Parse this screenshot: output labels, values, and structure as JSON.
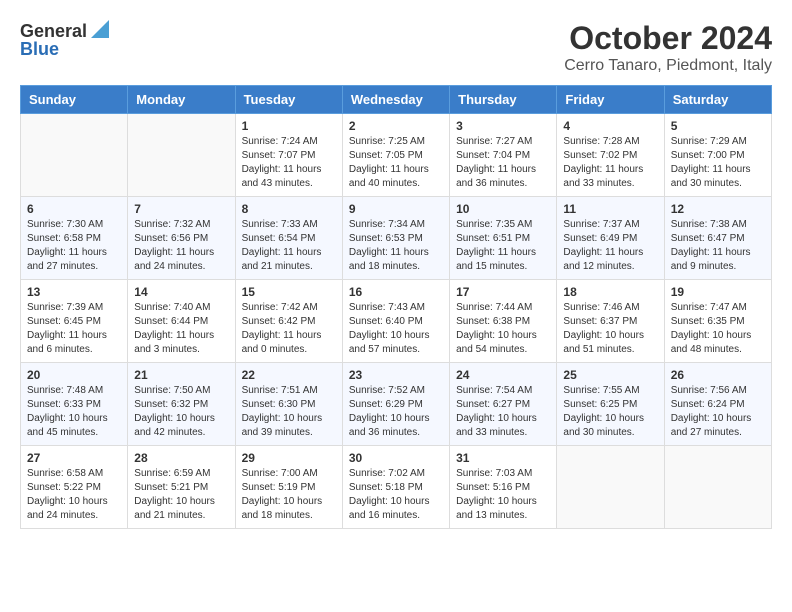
{
  "header": {
    "logo_general": "General",
    "logo_blue": "Blue",
    "month": "October 2024",
    "location": "Cerro Tanaro, Piedmont, Italy"
  },
  "weekdays": [
    "Sunday",
    "Monday",
    "Tuesday",
    "Wednesday",
    "Thursday",
    "Friday",
    "Saturday"
  ],
  "weeks": [
    [
      {
        "day": "",
        "sunrise": "",
        "sunset": "",
        "daylight": ""
      },
      {
        "day": "",
        "sunrise": "",
        "sunset": "",
        "daylight": ""
      },
      {
        "day": "1",
        "sunrise": "Sunrise: 7:24 AM",
        "sunset": "Sunset: 7:07 PM",
        "daylight": "Daylight: 11 hours and 43 minutes."
      },
      {
        "day": "2",
        "sunrise": "Sunrise: 7:25 AM",
        "sunset": "Sunset: 7:05 PM",
        "daylight": "Daylight: 11 hours and 40 minutes."
      },
      {
        "day": "3",
        "sunrise": "Sunrise: 7:27 AM",
        "sunset": "Sunset: 7:04 PM",
        "daylight": "Daylight: 11 hours and 36 minutes."
      },
      {
        "day": "4",
        "sunrise": "Sunrise: 7:28 AM",
        "sunset": "Sunset: 7:02 PM",
        "daylight": "Daylight: 11 hours and 33 minutes."
      },
      {
        "day": "5",
        "sunrise": "Sunrise: 7:29 AM",
        "sunset": "Sunset: 7:00 PM",
        "daylight": "Daylight: 11 hours and 30 minutes."
      }
    ],
    [
      {
        "day": "6",
        "sunrise": "Sunrise: 7:30 AM",
        "sunset": "Sunset: 6:58 PM",
        "daylight": "Daylight: 11 hours and 27 minutes."
      },
      {
        "day": "7",
        "sunrise": "Sunrise: 7:32 AM",
        "sunset": "Sunset: 6:56 PM",
        "daylight": "Daylight: 11 hours and 24 minutes."
      },
      {
        "day": "8",
        "sunrise": "Sunrise: 7:33 AM",
        "sunset": "Sunset: 6:54 PM",
        "daylight": "Daylight: 11 hours and 21 minutes."
      },
      {
        "day": "9",
        "sunrise": "Sunrise: 7:34 AM",
        "sunset": "Sunset: 6:53 PM",
        "daylight": "Daylight: 11 hours and 18 minutes."
      },
      {
        "day": "10",
        "sunrise": "Sunrise: 7:35 AM",
        "sunset": "Sunset: 6:51 PM",
        "daylight": "Daylight: 11 hours and 15 minutes."
      },
      {
        "day": "11",
        "sunrise": "Sunrise: 7:37 AM",
        "sunset": "Sunset: 6:49 PM",
        "daylight": "Daylight: 11 hours and 12 minutes."
      },
      {
        "day": "12",
        "sunrise": "Sunrise: 7:38 AM",
        "sunset": "Sunset: 6:47 PM",
        "daylight": "Daylight: 11 hours and 9 minutes."
      }
    ],
    [
      {
        "day": "13",
        "sunrise": "Sunrise: 7:39 AM",
        "sunset": "Sunset: 6:45 PM",
        "daylight": "Daylight: 11 hours and 6 minutes."
      },
      {
        "day": "14",
        "sunrise": "Sunrise: 7:40 AM",
        "sunset": "Sunset: 6:44 PM",
        "daylight": "Daylight: 11 hours and 3 minutes."
      },
      {
        "day": "15",
        "sunrise": "Sunrise: 7:42 AM",
        "sunset": "Sunset: 6:42 PM",
        "daylight": "Daylight: 11 hours and 0 minutes."
      },
      {
        "day": "16",
        "sunrise": "Sunrise: 7:43 AM",
        "sunset": "Sunset: 6:40 PM",
        "daylight": "Daylight: 10 hours and 57 minutes."
      },
      {
        "day": "17",
        "sunrise": "Sunrise: 7:44 AM",
        "sunset": "Sunset: 6:38 PM",
        "daylight": "Daylight: 10 hours and 54 minutes."
      },
      {
        "day": "18",
        "sunrise": "Sunrise: 7:46 AM",
        "sunset": "Sunset: 6:37 PM",
        "daylight": "Daylight: 10 hours and 51 minutes."
      },
      {
        "day": "19",
        "sunrise": "Sunrise: 7:47 AM",
        "sunset": "Sunset: 6:35 PM",
        "daylight": "Daylight: 10 hours and 48 minutes."
      }
    ],
    [
      {
        "day": "20",
        "sunrise": "Sunrise: 7:48 AM",
        "sunset": "Sunset: 6:33 PM",
        "daylight": "Daylight: 10 hours and 45 minutes."
      },
      {
        "day": "21",
        "sunrise": "Sunrise: 7:50 AM",
        "sunset": "Sunset: 6:32 PM",
        "daylight": "Daylight: 10 hours and 42 minutes."
      },
      {
        "day": "22",
        "sunrise": "Sunrise: 7:51 AM",
        "sunset": "Sunset: 6:30 PM",
        "daylight": "Daylight: 10 hours and 39 minutes."
      },
      {
        "day": "23",
        "sunrise": "Sunrise: 7:52 AM",
        "sunset": "Sunset: 6:29 PM",
        "daylight": "Daylight: 10 hours and 36 minutes."
      },
      {
        "day": "24",
        "sunrise": "Sunrise: 7:54 AM",
        "sunset": "Sunset: 6:27 PM",
        "daylight": "Daylight: 10 hours and 33 minutes."
      },
      {
        "day": "25",
        "sunrise": "Sunrise: 7:55 AM",
        "sunset": "Sunset: 6:25 PM",
        "daylight": "Daylight: 10 hours and 30 minutes."
      },
      {
        "day": "26",
        "sunrise": "Sunrise: 7:56 AM",
        "sunset": "Sunset: 6:24 PM",
        "daylight": "Daylight: 10 hours and 27 minutes."
      }
    ],
    [
      {
        "day": "27",
        "sunrise": "Sunrise: 6:58 AM",
        "sunset": "Sunset: 5:22 PM",
        "daylight": "Daylight: 10 hours and 24 minutes."
      },
      {
        "day": "28",
        "sunrise": "Sunrise: 6:59 AM",
        "sunset": "Sunset: 5:21 PM",
        "daylight": "Daylight: 10 hours and 21 minutes."
      },
      {
        "day": "29",
        "sunrise": "Sunrise: 7:00 AM",
        "sunset": "Sunset: 5:19 PM",
        "daylight": "Daylight: 10 hours and 18 minutes."
      },
      {
        "day": "30",
        "sunrise": "Sunrise: 7:02 AM",
        "sunset": "Sunset: 5:18 PM",
        "daylight": "Daylight: 10 hours and 16 minutes."
      },
      {
        "day": "31",
        "sunrise": "Sunrise: 7:03 AM",
        "sunset": "Sunset: 5:16 PM",
        "daylight": "Daylight: 10 hours and 13 minutes."
      },
      {
        "day": "",
        "sunrise": "",
        "sunset": "",
        "daylight": ""
      },
      {
        "day": "",
        "sunrise": "",
        "sunset": "",
        "daylight": ""
      }
    ]
  ]
}
